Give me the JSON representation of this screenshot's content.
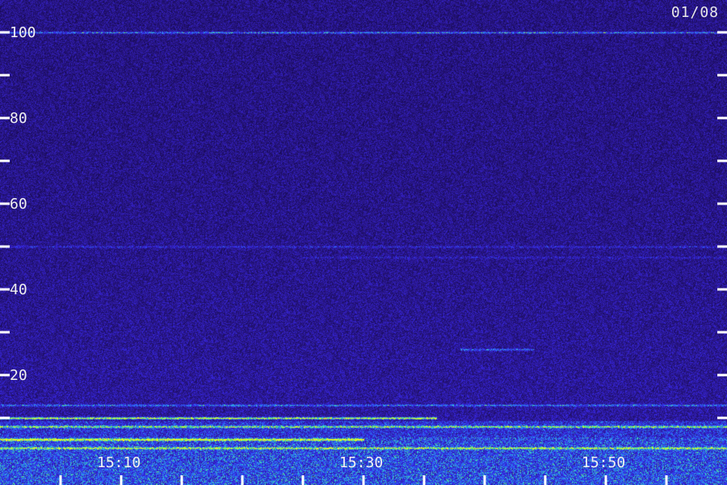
{
  "date_label": "01/08",
  "colors": {
    "background": "#1f0f63",
    "noise_mid": "#3a22c8",
    "noise_high": "#2a5cf0",
    "band_cyan": "#39d9d0",
    "band_green": "#7af040",
    "band_yellow": "#e8f020",
    "tick": "#ffffff"
  },
  "chart_data": {
    "type": "heatmap",
    "title": "",
    "xlabel": "",
    "ylabel": "",
    "ylim": [
      0,
      102
    ],
    "y_ticks_labeled": [
      20,
      40,
      60,
      80,
      100
    ],
    "y_ticks_minor": [
      10,
      30,
      50,
      70,
      90
    ],
    "x_range_minutes": [
      "15:00",
      "16:00"
    ],
    "x_ticks_labeled": [
      "15:10",
      "15:30",
      "15:50"
    ],
    "x_ticks_minor": [
      "15:05",
      "15:15",
      "15:20",
      "15:25",
      "15:35",
      "15:40",
      "15:45",
      "15:55"
    ],
    "features": [
      {
        "name": "continuous line",
        "y": 100,
        "from": "15:00",
        "to": "16:00",
        "intensity": 0.55
      },
      {
        "name": "faint band",
        "y": 50,
        "from": "15:00",
        "to": "16:00",
        "intensity": 0.25
      },
      {
        "name": "faint band",
        "y": 47.5,
        "from": "15:25",
        "to": "16:00",
        "intensity": 0.2
      },
      {
        "name": "short line",
        "y": 26,
        "from": "15:38",
        "to": "15:44",
        "intensity": 0.45
      },
      {
        "name": "low-frequency band",
        "y": 13,
        "from": "15:00",
        "to": "16:00",
        "intensity": 0.45
      },
      {
        "name": "low-frequency band",
        "y": 10,
        "from": "15:00",
        "to": "15:36",
        "intensity": 0.95
      },
      {
        "name": "low-frequency band",
        "y": 8,
        "from": "15:00",
        "to": "16:00",
        "intensity": 0.6
      },
      {
        "name": "low-frequency band",
        "y": 5,
        "from": "15:00",
        "to": "15:30",
        "intensity": 0.8
      },
      {
        "name": "low-frequency band",
        "y": 3,
        "from": "15:00",
        "to": "16:00",
        "intensity": 0.55
      }
    ]
  }
}
